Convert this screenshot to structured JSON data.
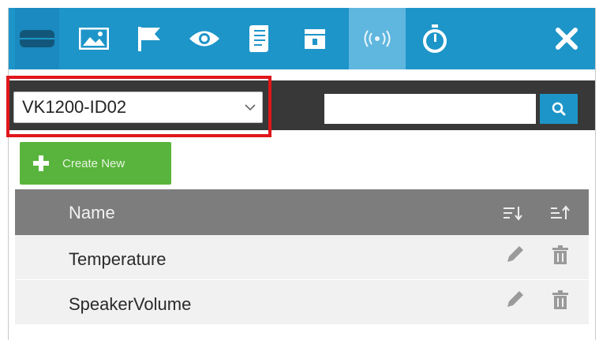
{
  "toolbar": {
    "icons": [
      "device-icon",
      "image-icon",
      "flag-icon",
      "eye-icon",
      "document-icon",
      "calendar-icon",
      "broadcast-icon",
      "stopwatch-icon"
    ],
    "selected_icon": "broadcast-icon",
    "close_icon": "close-icon"
  },
  "filter": {
    "device_selected": "VK1200-ID02",
    "search_value": "",
    "search_placeholder": ""
  },
  "create_button": {
    "label": "Create New"
  },
  "table": {
    "column_name": "Name",
    "rows": [
      {
        "name": "Temperature"
      },
      {
        "name": "SpeakerVolume"
      }
    ]
  },
  "colors": {
    "toolbar_bg": "#1d95c9",
    "selected_tab": "#5fb6de",
    "dark_bar": "#383838",
    "create_green": "#58b43c",
    "header_gray": "#7d7d7d",
    "row_bg": "#f1f1f1",
    "highlight_red": "#e0161b"
  }
}
